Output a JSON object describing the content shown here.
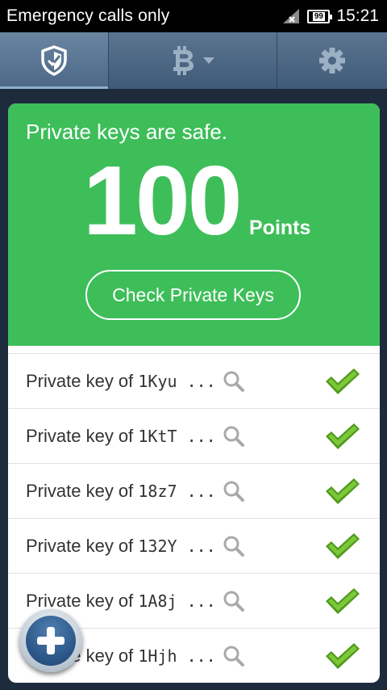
{
  "status_bar": {
    "carrier_text": "Emergency calls only",
    "battery_level": "99",
    "time": "15:21"
  },
  "tabs": [
    {
      "name": "security",
      "icon": "shield-check-icon",
      "active": true
    },
    {
      "name": "wallet",
      "icon": "bitcoin-icon",
      "has_dropdown": true,
      "active": false
    },
    {
      "name": "settings",
      "icon": "gear-icon",
      "active": false
    }
  ],
  "hero": {
    "status_text": "Private keys are safe.",
    "score": "100",
    "score_unit": "Points",
    "button_label": "Check Private Keys",
    "color": "#3dbe59"
  },
  "keys": [
    {
      "prefix": "Private key of ",
      "address": "1Kyu ...",
      "status": "safe"
    },
    {
      "prefix": "Private key of ",
      "address": "1KtT ...",
      "status": "safe"
    },
    {
      "prefix": "Private key of ",
      "address": "18z7 ...",
      "status": "safe"
    },
    {
      "prefix": "Private key of ",
      "address": "132Y ...",
      "status": "safe"
    },
    {
      "prefix": "Private key of ",
      "address": "1A8j ...",
      "status": "safe"
    },
    {
      "prefix": "Private key of ",
      "address": "1Hjh ...",
      "status": "safe"
    }
  ],
  "fab": {
    "icon": "plus-icon"
  },
  "colors": {
    "tab_bar": "#4b6785",
    "background": "#1d2b3d",
    "check": "#6abf2a"
  }
}
